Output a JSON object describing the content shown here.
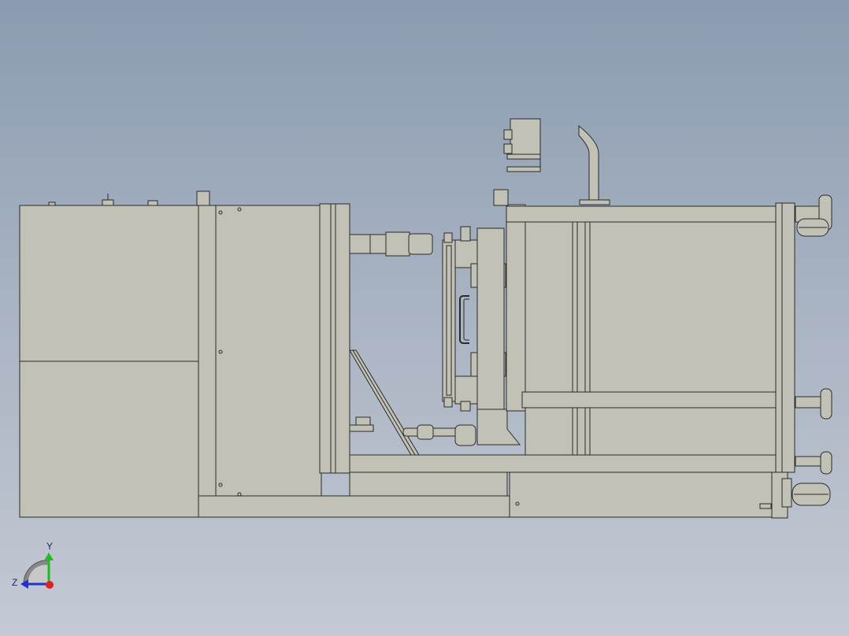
{
  "viewport": {
    "background_top": "#8a9bb1",
    "background_bottom": "#c4c9d4",
    "part_fill": "#c2c1b6",
    "part_fill_dark": "#b5b4a8",
    "edge_color": "#2a2a2a"
  },
  "triad": {
    "y_label": "Y",
    "z_label": "Z",
    "y_color": "#22bb22",
    "z_color": "#2233cc",
    "x_color": "#dd2222"
  }
}
